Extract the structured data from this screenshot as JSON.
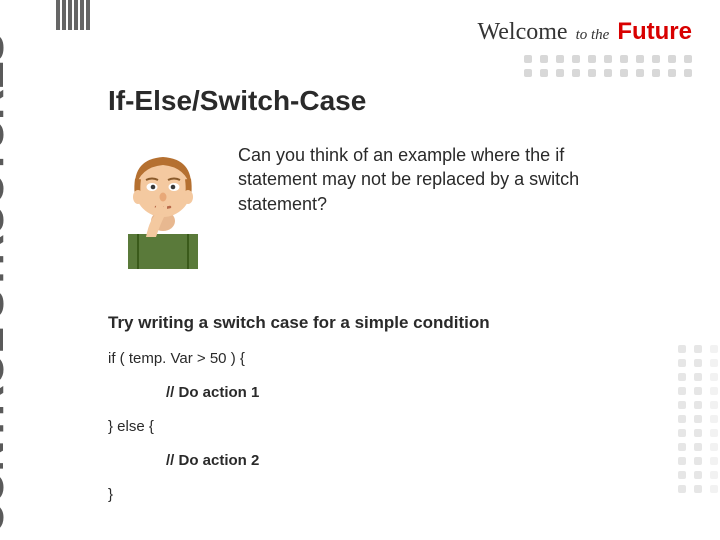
{
  "sidebar_label": "CONTROL STRUCTURES",
  "header": {
    "welcome": "Welcome",
    "to_the": "to the",
    "future": "Future"
  },
  "slide": {
    "title": "If-Else/Switch-Case",
    "question": "Can you think of an example where the if statement may not be replaced by a switch statement?",
    "try_line": "Try writing a switch case for a simple condition",
    "code": {
      "l1": "if ( temp. Var > 50 ) {",
      "l2": "// Do action 1",
      "l3": "} else {",
      "l4": "// Do action 2",
      "l5": "}"
    }
  }
}
